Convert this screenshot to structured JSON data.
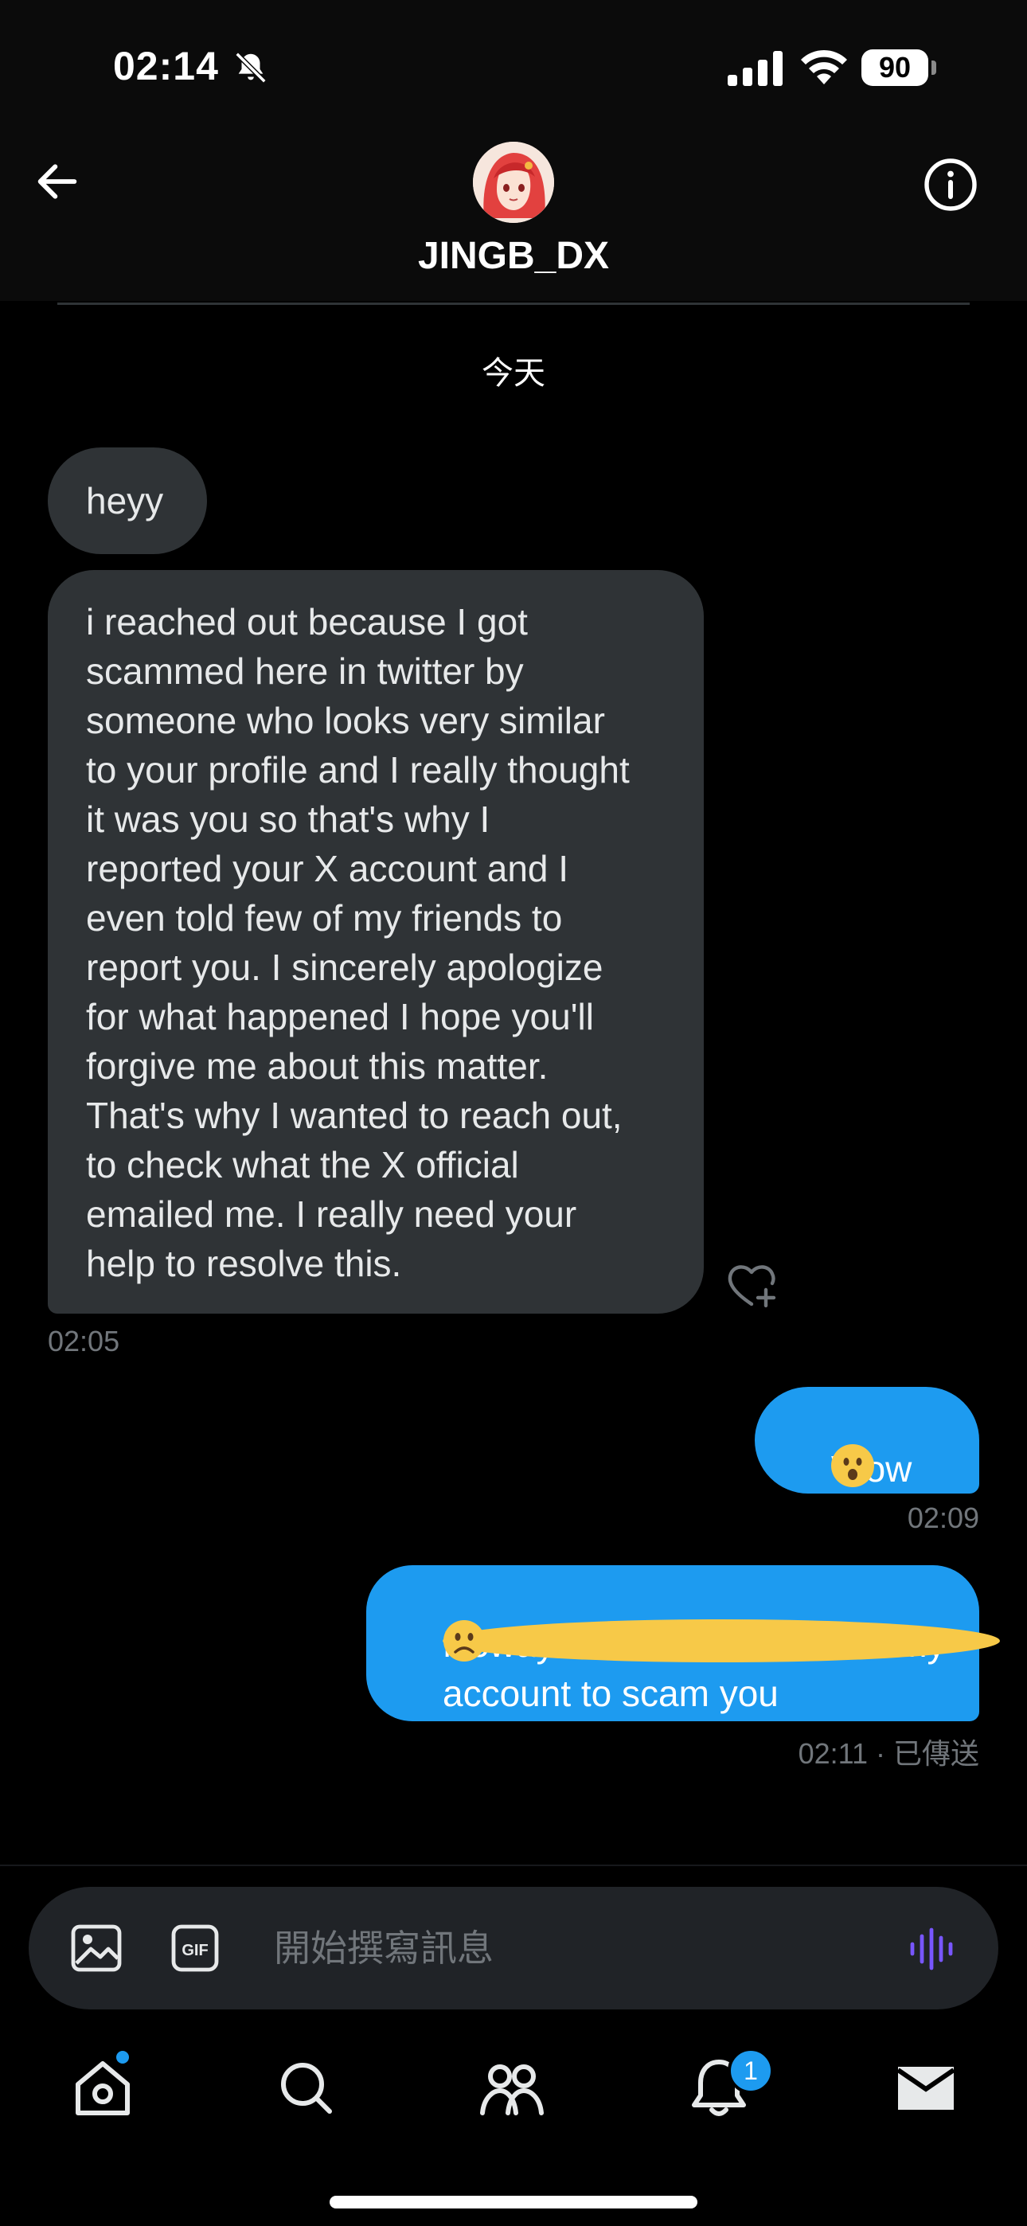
{
  "status_bar": {
    "time": "02:14",
    "battery": "90"
  },
  "header": {
    "username": "JINGB_DX",
    "back_icon": "arrow-left-icon",
    "info_icon": "info-circle-icon"
  },
  "conversation": {
    "date_label": "今天",
    "messages": [
      {
        "direction": "in",
        "text": "heyy"
      },
      {
        "direction": "in",
        "text": "i  reached out because I got\nscammed here in twitter by\nsomeone who looks very similar\nto your profile and I really thought\nit was you so that's why I\nreported your X account and I\neven told few of my friends to\nreport you. I sincerely apologize\nfor what happened I hope you'll\nforgive me about this matter.\nThat's why I wanted to reach out,\nto check what the X official\nemailed me. I really need your\nhelp to resolve this.",
        "time": "02:05"
      },
      {
        "direction": "out",
        "text": "Wow ",
        "emoji": "hushed-face-emoji",
        "time": "02:09"
      },
      {
        "direction": "out",
        "text": "Noway that someone faked my account to scam you",
        "emoji": "frowning-face-emoji",
        "time": "02:11",
        "status": "已傳送"
      }
    ]
  },
  "composer": {
    "placeholder": "開始撰寫訊息",
    "gif_label": "GIF"
  },
  "bottom_nav": {
    "items": [
      "home-icon",
      "search-icon",
      "communities-icon",
      "notifications-icon",
      "messages-icon"
    ],
    "notification_count": "1"
  },
  "colors": {
    "accent": "#1d9bf0",
    "incoming_bubble": "#2f3336",
    "voice_icon": "#7856ff"
  }
}
